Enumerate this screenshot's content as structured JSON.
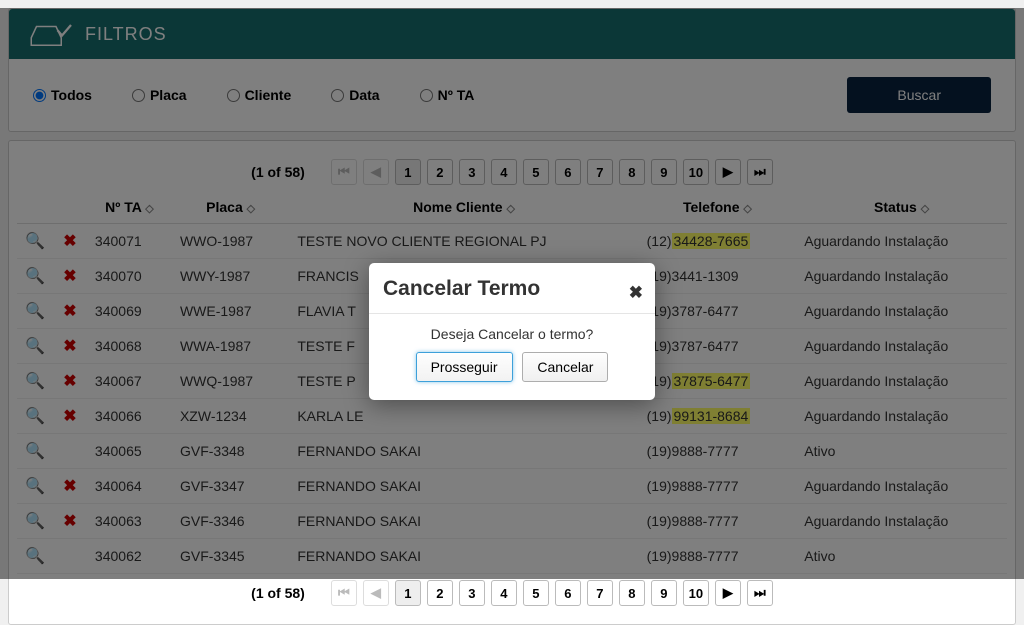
{
  "header": {
    "title": "FILTROS"
  },
  "filters": {
    "options": [
      {
        "label": "Todos",
        "checked": true
      },
      {
        "label": "Placa",
        "checked": false
      },
      {
        "label": "Cliente",
        "checked": false
      },
      {
        "label": "Data",
        "checked": false
      },
      {
        "label": "Nº TA",
        "checked": false
      }
    ],
    "search_label": "Buscar"
  },
  "pagination": {
    "info": "(1 of 58)",
    "pages": [
      "1",
      "2",
      "3",
      "4",
      "5",
      "6",
      "7",
      "8",
      "9",
      "10"
    ],
    "active": "1"
  },
  "columns": [
    "",
    "",
    "Nº TA",
    "Placa",
    "Nome Cliente",
    "Telefone",
    "Status"
  ],
  "rows": [
    {
      "ta": "340071",
      "placa": "WWO-1987",
      "nome": "TESTE NOVO CLIENTE REGIONAL PJ",
      "tel_prefix": "(12)",
      "tel_num": "34428-7665",
      "tel_hl": true,
      "status": "Aguardando Instalação",
      "cancel": true
    },
    {
      "ta": "340070",
      "placa": "WWY-1987",
      "nome": "FRANCIS",
      "tel_prefix": "(19)",
      "tel_num": "3441-1309",
      "tel_hl": false,
      "status": "Aguardando Instalação",
      "cancel": true
    },
    {
      "ta": "340069",
      "placa": "WWE-1987",
      "nome": "FLAVIA T",
      "tel_prefix": "(19)",
      "tel_num": "3787-6477",
      "tel_hl": false,
      "status": "Aguardando Instalação",
      "cancel": true
    },
    {
      "ta": "340068",
      "placa": "WWA-1987",
      "nome": "TESTE F",
      "tel_prefix": "(19)",
      "tel_num": "3787-6477",
      "tel_hl": false,
      "status": "Aguardando Instalação",
      "cancel": true
    },
    {
      "ta": "340067",
      "placa": "WWQ-1987",
      "nome": "TESTE P",
      "tel_prefix": "(19)",
      "tel_num": "37875-6477",
      "tel_hl": true,
      "status": "Aguardando Instalação",
      "cancel": true
    },
    {
      "ta": "340066",
      "placa": "XZW-1234",
      "nome": "KARLA LE",
      "tel_prefix": "(19)",
      "tel_num": "99131-8684",
      "tel_hl": true,
      "status": "Aguardando Instalação",
      "cancel": true
    },
    {
      "ta": "340065",
      "placa": "GVF-3348",
      "nome": "FERNANDO SAKAI",
      "tel_prefix": "(19)",
      "tel_num": "9888-7777",
      "tel_hl": false,
      "status": "Ativo",
      "cancel": false
    },
    {
      "ta": "340064",
      "placa": "GVF-3347",
      "nome": "FERNANDO SAKAI",
      "tel_prefix": "(19)",
      "tel_num": "9888-7777",
      "tel_hl": false,
      "status": "Aguardando Instalação",
      "cancel": true
    },
    {
      "ta": "340063",
      "placa": "GVF-3346",
      "nome": "FERNANDO SAKAI",
      "tel_prefix": "(19)",
      "tel_num": "9888-7777",
      "tel_hl": false,
      "status": "Aguardando Instalação",
      "cancel": true
    },
    {
      "ta": "340062",
      "placa": "GVF-3345",
      "nome": "FERNANDO SAKAI",
      "tel_prefix": "(19)",
      "tel_num": "9888-7777",
      "tel_hl": false,
      "status": "Ativo",
      "cancel": false
    }
  ],
  "modal": {
    "title": "Cancelar Termo",
    "message": "Deseja Cancelar o termo?",
    "proceed": "Prosseguir",
    "cancel": "Cancelar"
  }
}
